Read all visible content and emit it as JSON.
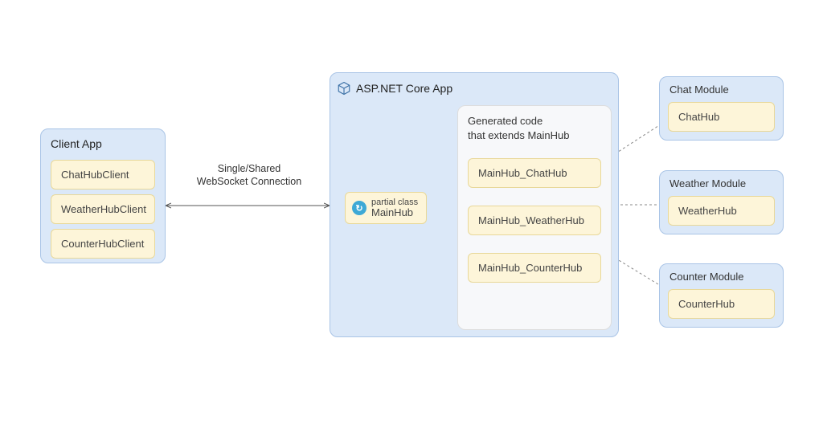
{
  "clientApp": {
    "title": "Client App",
    "items": [
      "ChatHubClient",
      "WeatherHubClient",
      "CounterHubClient"
    ]
  },
  "connectionLabel": {
    "line1": "Single/Shared",
    "line2": "WebSocket Connection"
  },
  "serverApp": {
    "title": "ASP.NET Core App",
    "mainHub": {
      "classLabel": "partial class",
      "name": "MainHub"
    },
    "generated": {
      "title": "Generated code\nthat extends MainHub",
      "items": [
        "MainHub_ChatHub",
        "MainHub_WeatherHub",
        "MainHub_CounterHub"
      ]
    }
  },
  "modules": [
    {
      "title": "Chat Module",
      "hub": "ChatHub"
    },
    {
      "title": "Weather Module",
      "hub": "WeatherHub"
    },
    {
      "title": "Counter Module",
      "hub": "CounterHub"
    }
  ]
}
